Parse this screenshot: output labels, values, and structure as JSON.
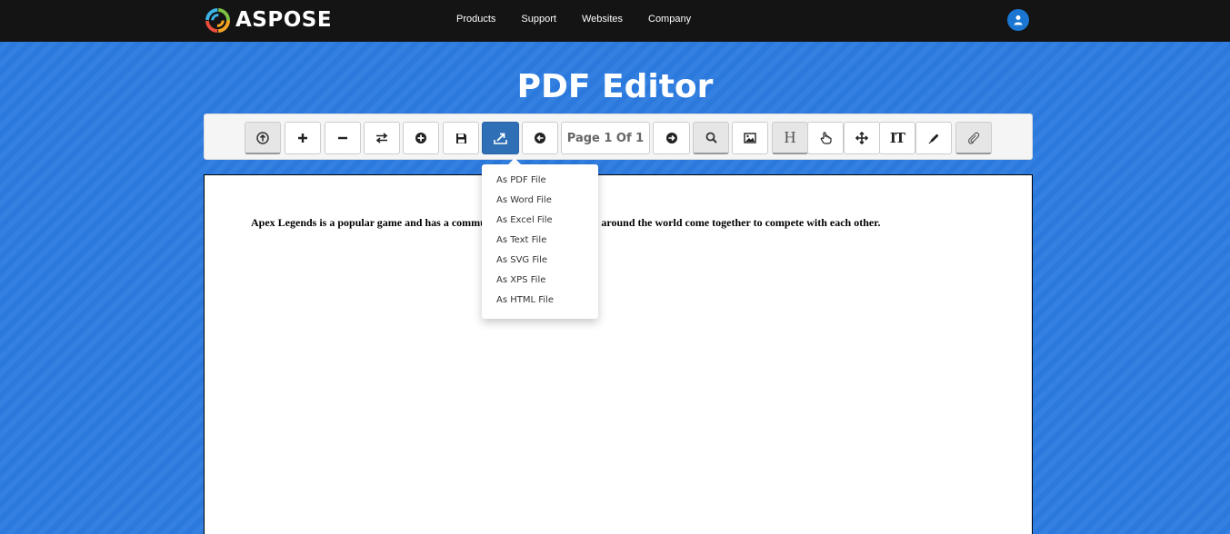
{
  "header": {
    "brand": "ASPOSE",
    "nav": [
      "Products",
      "Support",
      "Websites",
      "Company"
    ]
  },
  "page_title": "PDF Editor",
  "toolbar": {
    "page_indicator": "Page 1 Of 1",
    "heading_glyph": "H",
    "text_glyph": "IT"
  },
  "dropdown": {
    "items": [
      "As PDF File",
      "As Word File",
      "As Excel File",
      "As Text File",
      "As SVG File",
      "As XPS File",
      "As HTML File"
    ]
  },
  "document": {
    "text": "Apex Legends is a popular game and has a community where professionals around the world come together to compete with each other."
  },
  "colors": {
    "background": "#2c7be0",
    "topbar": "#141414",
    "active_button": "#2f6fb5"
  }
}
